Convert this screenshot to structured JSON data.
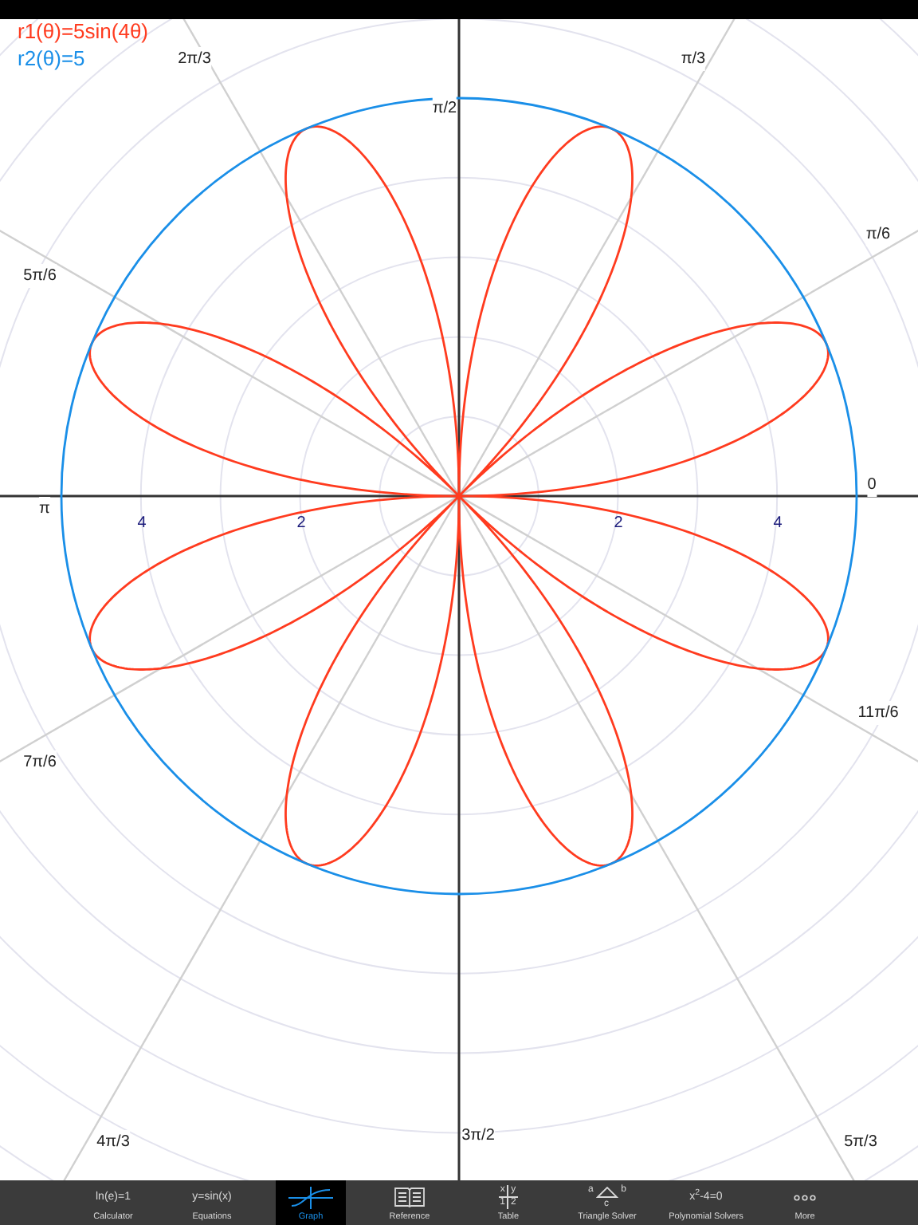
{
  "graph": {
    "equations": [
      {
        "label": "r1(θ)=5sin(4θ)",
        "color": "#ff3b1f",
        "kind": "rose"
      },
      {
        "label": "r2(θ)=5",
        "color": "#1a8fe8",
        "kind": "circle"
      }
    ],
    "angle_labels": [
      "2π/3",
      "π/3",
      "π/2",
      "π/6",
      "5π/6",
      "0",
      "π",
      "11π/6",
      "7π/6",
      "3π/2",
      "4π/3",
      "5π/3"
    ],
    "radius_labels": [
      "4",
      "2",
      "2",
      "4"
    ]
  },
  "tab_bar": [
    {
      "label": "Calculator",
      "icon": "ln(e)=1",
      "kind": "text",
      "selected": false
    },
    {
      "label": "Equations",
      "icon": "y=sin(x)",
      "kind": "text",
      "selected": false
    },
    {
      "label": "Graph",
      "kind": "graph",
      "selected": true
    },
    {
      "label": "Reference",
      "kind": "book",
      "selected": false
    },
    {
      "label": "Table",
      "kind": "table",
      "icon_cells": [
        "x",
        "y",
        "1",
        "2"
      ],
      "selected": false
    },
    {
      "label": "Triangle Solver",
      "kind": "triangle",
      "icon_cells": [
        "a",
        "b",
        "c"
      ],
      "selected": false
    },
    {
      "label": "Polynomial Solvers",
      "icon": "x$^{2}$-4=0",
      "kind": "text",
      "selected": false
    },
    {
      "label": "More",
      "kind": "dots",
      "selected": false
    }
  ]
}
